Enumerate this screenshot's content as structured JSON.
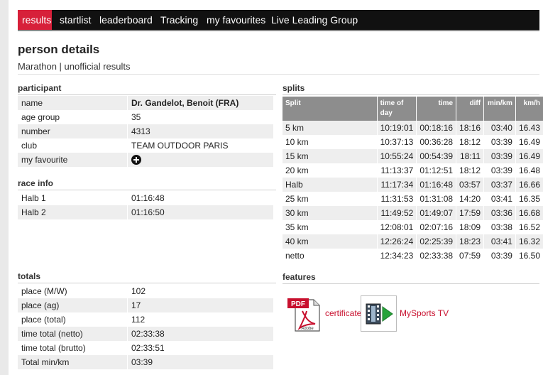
{
  "nav": {
    "tabs": [
      {
        "label": "results"
      },
      {
        "label": "startlist"
      },
      {
        "label": "leaderboard"
      },
      {
        "label": "Tracking"
      },
      {
        "label": "my favourites"
      },
      {
        "label": "Live Leading Group"
      }
    ],
    "active": "results"
  },
  "page": {
    "title": "person details",
    "subtitle": "Marathon | unofficial results"
  },
  "participant": {
    "title": "participant",
    "rows": [
      {
        "k": "name",
        "v": "Dr. Gandelot, Benoit (FRA)"
      },
      {
        "k": "age group",
        "v": "35"
      },
      {
        "k": "number",
        "v": "4313"
      },
      {
        "k": "club",
        "v": "TEAM OUTDOOR PARIS"
      },
      {
        "k": "my favourite",
        "v": ""
      }
    ],
    "favourite_icon": "plus-circle-icon"
  },
  "race_info": {
    "title": "race info",
    "rows": [
      {
        "k": "Halb 1",
        "v": "01:16:48"
      },
      {
        "k": "Halb 2",
        "v": "01:16:50"
      }
    ]
  },
  "totals": {
    "title": "totals",
    "rows": [
      {
        "k": "place (M/W)",
        "v": "102"
      },
      {
        "k": "place (ag)",
        "v": "17"
      },
      {
        "k": "place (total)",
        "v": "112"
      },
      {
        "k": "time total (netto)",
        "v": "02:33:38"
      },
      {
        "k": "time total (brutto)",
        "v": "02:33:51"
      },
      {
        "k": "Total min/km",
        "v": "03:39"
      }
    ]
  },
  "splits": {
    "title": "splits",
    "headers": [
      "Split",
      "time of day",
      "time",
      "diff",
      "min/km",
      "km/h"
    ],
    "rows": [
      [
        "5 km",
        "10:19:01",
        "00:18:16",
        "18:16",
        "03:40",
        "16.43"
      ],
      [
        "10 km",
        "10:37:13",
        "00:36:28",
        "18:12",
        "03:39",
        "16.49"
      ],
      [
        "15 km",
        "10:55:24",
        "00:54:39",
        "18:11",
        "03:39",
        "16.49"
      ],
      [
        "20 km",
        "11:13:37",
        "01:12:51",
        "18:12",
        "03:39",
        "16.48"
      ],
      [
        "Halb",
        "11:17:34",
        "01:16:48",
        "03:57",
        "03:37",
        "16.66"
      ],
      [
        "25 km",
        "11:31:53",
        "01:31:08",
        "14:20",
        "03:41",
        "16.35"
      ],
      [
        "30 km",
        "11:49:52",
        "01:49:07",
        "17:59",
        "03:36",
        "16.68"
      ],
      [
        "35 km",
        "12:08:01",
        "02:07:16",
        "18:09",
        "03:38",
        "16.52"
      ],
      [
        "40 km",
        "12:26:24",
        "02:25:39",
        "18:23",
        "03:41",
        "16.32"
      ],
      [
        "netto",
        "12:34:23",
        "02:33:38",
        "07:59",
        "03:39",
        "16.50"
      ]
    ]
  },
  "features": {
    "title": "features",
    "items": [
      {
        "label": "certificate",
        "icon": "pdf-document-icon",
        "icon_text": "PDF",
        "icon_sub": "Adobe"
      },
      {
        "label": "MySports TV",
        "icon": "video-play-icon"
      }
    ]
  },
  "colors": {
    "accent": "#d7203a",
    "nav_bg": "#111111",
    "header_gray": "#8d8d8d",
    "row_alt": "#eeeeee",
    "link": "#c8102e"
  }
}
